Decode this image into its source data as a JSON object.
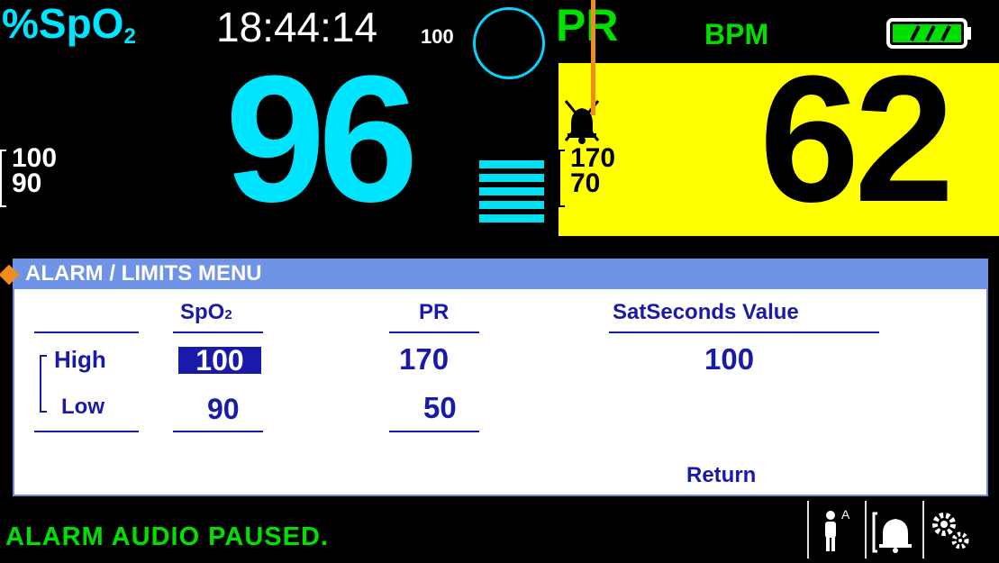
{
  "top": {
    "spo2_label": "%SpO",
    "spo2_sub": "2",
    "clock": "18:44:14",
    "pleth_max": "100",
    "pr_label": "PR",
    "bpm_label": "BPM",
    "spo2_value": "96",
    "spo2_limit_high": "100",
    "spo2_limit_low": "90",
    "pr_value": "62",
    "pr_limit_high": "170",
    "pr_limit_low": "70",
    "battery_level": 1.0,
    "signal_bars": 5
  },
  "menu": {
    "title": "ALARM / LIMITS MENU",
    "col_spo2": "SpO",
    "col_spo2_sub": "2",
    "col_pr": "PR",
    "col_satseconds": "SatSeconds Value",
    "row_high": "High",
    "row_low": "Low",
    "spo2_high": "100",
    "spo2_low": "90",
    "pr_high": "170",
    "pr_low": "50",
    "satseconds_value": "100",
    "return_label": "Return"
  },
  "status": {
    "message": "ALARM AUDIO PAUSED."
  },
  "icons": [
    "patient-mode-icon",
    "alarm-bell-icon",
    "settings-gears-icon",
    "alarm-silenced-icon",
    "battery-icon"
  ],
  "colors": {
    "spo2": "#00e5ff",
    "pr": "#00e000",
    "pr_panel": "#ffff00",
    "menu_header": "#6f93e6",
    "menu_text": "#1a1aa8",
    "marker": "#f08c1e"
  }
}
